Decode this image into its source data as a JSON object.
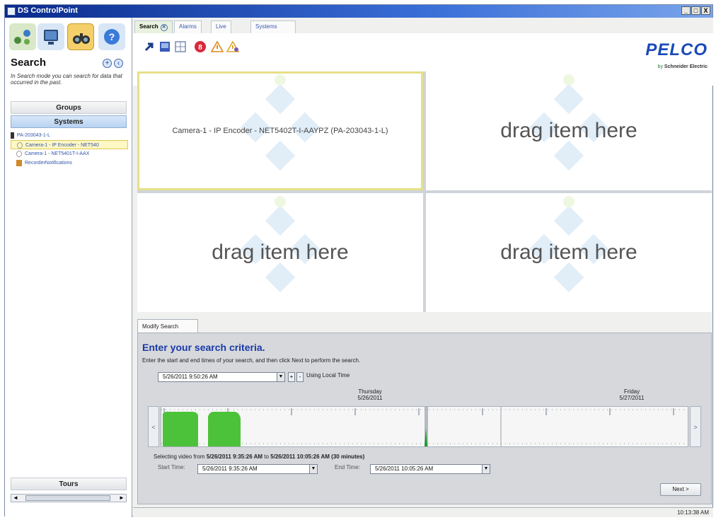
{
  "window": {
    "title": "DS ControlPoint",
    "buttons": [
      "_",
      "□",
      "X"
    ]
  },
  "left_pane": {
    "mode_icons": [
      "systems-icon",
      "monitor-icon",
      "binoculars-icon",
      "help-icon"
    ],
    "title": "Search",
    "description": "In Search mode you can search for data that occurred in the past.",
    "groups_label": "Groups",
    "systems_label": "Systems",
    "tree": [
      {
        "label": "PA-203043-1-L",
        "icon": "server-icon"
      },
      {
        "label": "Camera-1 - IP Encoder - NET540",
        "icon": "camera-icon",
        "selected": true
      },
      {
        "label": "Camera-1 - NET5401T-I-AAX",
        "icon": "camera-icon"
      },
      {
        "label": "RecorderNotifications",
        "icon": "notification-icon"
      }
    ],
    "tours_label": "Tours"
  },
  "tabs": [
    {
      "label": "Search",
      "active": true
    },
    {
      "label": "Alarms"
    },
    {
      "label": "Live"
    },
    {
      "label": "Systems"
    }
  ],
  "brand": {
    "logo": "PELCO",
    "sub_prefix": "by",
    "sub": "Schneider Electric"
  },
  "video_cells": [
    {
      "text": "Camera-1 - IP Encoder - NET5402T-I-AAYPZ (PA-203043-1-L)"
    },
    {
      "text": "drag item here"
    },
    {
      "text": "drag item here"
    },
    {
      "text": "drag item here"
    }
  ],
  "modify_search": {
    "tab_label": "Modify Search",
    "title": "Enter your search criteria.",
    "instructions": "Enter the start and end times of your search, and then click Next to perform the search.",
    "datetime": "5/26/2011  9:50:26 AM",
    "plus": "+",
    "minus": "-",
    "local_time": "Using Local Time",
    "day1": {
      "weekday": "Thursday",
      "date": "5/26/2011"
    },
    "day2": {
      "weekday": "Friday",
      "date": "5/27/2011"
    },
    "selection_prefix": "Selecting video from",
    "selection_from": "5/26/2011 9:35:26 AM",
    "selection_to_word": "to",
    "selection_to": "5/26/2011 10:05:26 AM",
    "selection_duration": "(30 minutes)",
    "start_label": "Start Time:",
    "start_value": "5/26/2011  9:35:26 AM",
    "end_label": "End Time:",
    "end_value": "5/26/2011 10:05:26 AM",
    "next_label": "Next >",
    "prev_arrow": "<",
    "next_arrow": ">"
  },
  "status": {
    "clock": "10:13:38 AM"
  },
  "colors": {
    "accent": "#1a3aa8",
    "recorded_green": "#4cc23a",
    "selection": "#e6e08a"
  }
}
